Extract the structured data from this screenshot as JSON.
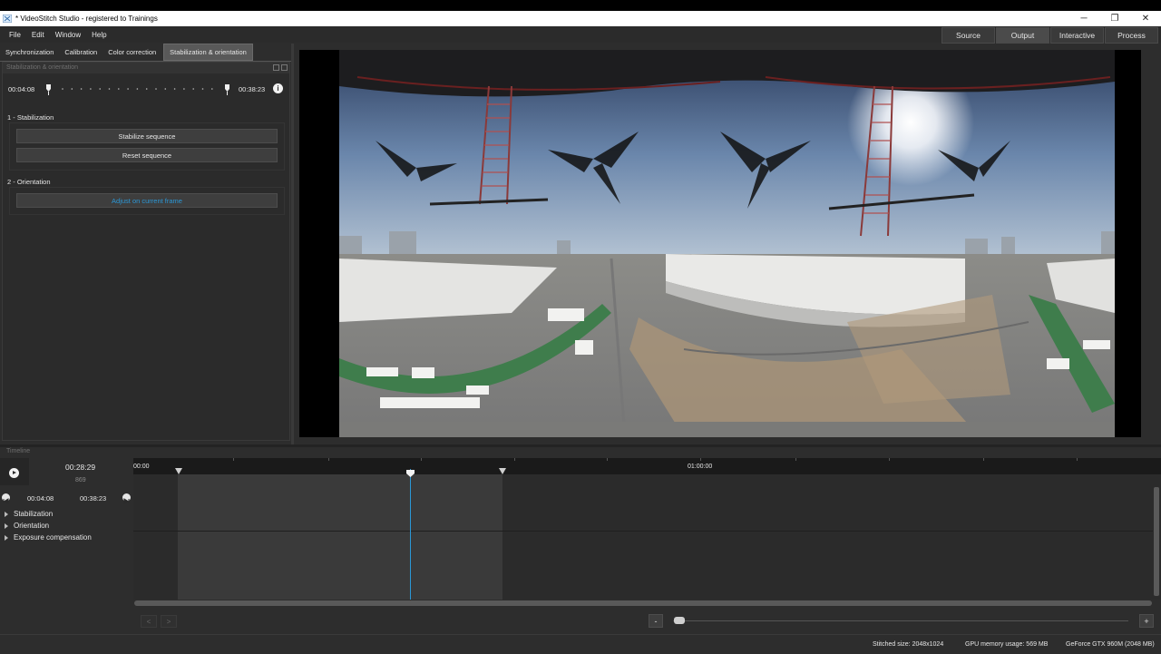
{
  "window": {
    "title": "* VideoStitch Studio - registered to Trainings",
    "minimize": "─",
    "maximize": "❐",
    "close": "✕"
  },
  "menu": [
    "File",
    "Edit",
    "Window",
    "Help"
  ],
  "topnav": [
    "Source",
    "Output",
    "Interactive",
    "Process"
  ],
  "tabs": [
    "Synchronization",
    "Calibration",
    "Color correction",
    "Stabilization & orientation"
  ],
  "panel": {
    "title": "Stabilization & orientation",
    "range_start": "00:04:08",
    "range_end": "00:38:23",
    "info_glyph": "i",
    "section1": "1 - Stabilization",
    "stabilize_label": "Stabilize sequence",
    "reset_label": "Reset sequence",
    "section2": "2 - Orientation",
    "adjust_label": "Adjust on current frame"
  },
  "timeline": {
    "label": "Timeline",
    "current_time": "00:28:29",
    "current_frame": "869",
    "range_start": "00:04:08",
    "range_end": "00:38:23",
    "ruler_start": "00:00",
    "ruler_mark": "01:00:00",
    "tracks": [
      "Stabilization",
      "Orientation",
      "Exposure compensation"
    ],
    "prev_label": "<",
    "next_label": ">",
    "zoom_out": "-",
    "zoom_in": "+"
  },
  "status": {
    "stitched_size": "Stitched size: 2048x1024",
    "gpu_memory": "GPU memory usage: 569 MB",
    "gpu_name": "GeForce GTX 960M (2048 MB)"
  },
  "colors": {
    "accent": "#2b97d6",
    "background": "#2d2d2d"
  }
}
